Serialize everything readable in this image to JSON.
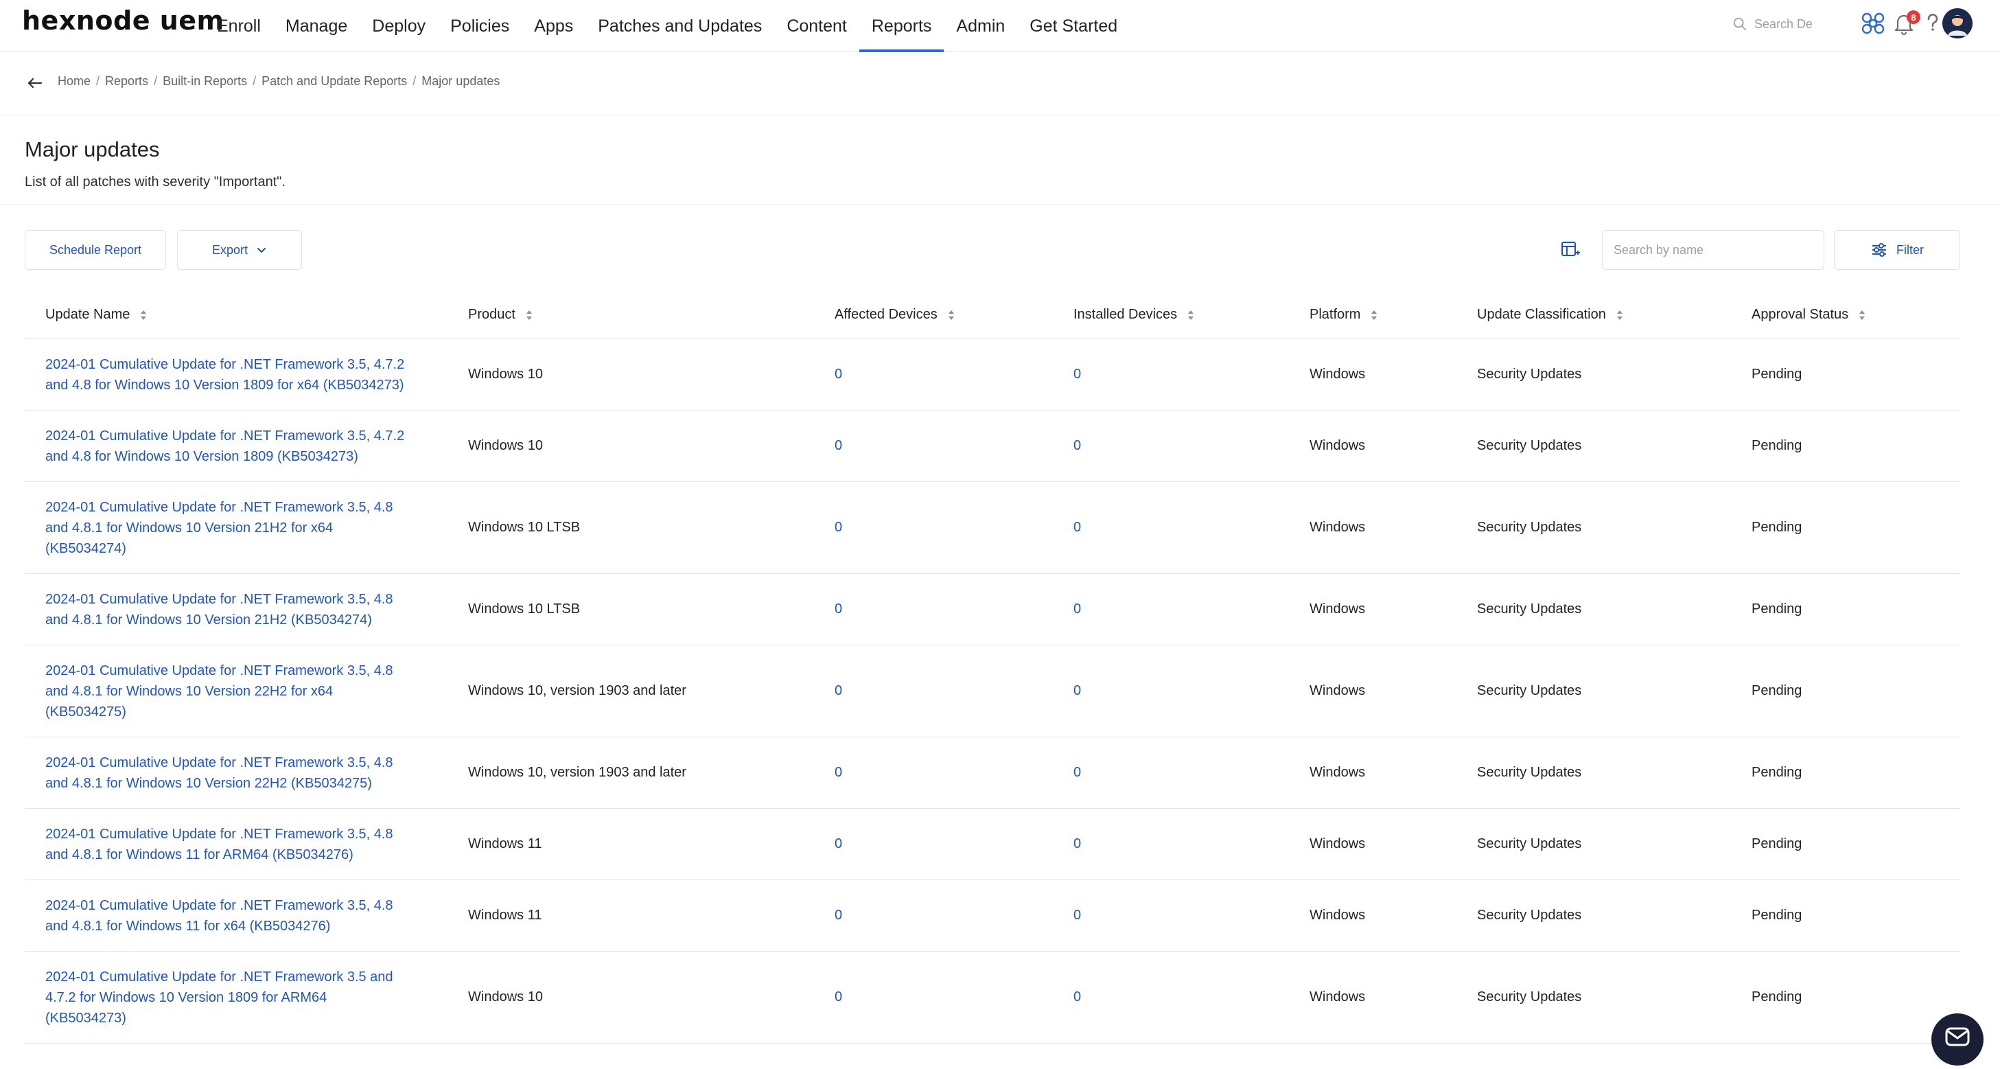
{
  "brand": {
    "logo_text": "hexnode uem"
  },
  "nav": {
    "items": [
      {
        "label": "Enroll"
      },
      {
        "label": "Manage"
      },
      {
        "label": "Deploy"
      },
      {
        "label": "Policies"
      },
      {
        "label": "Apps"
      },
      {
        "label": "Patches and Updates"
      },
      {
        "label": "Content"
      },
      {
        "label": "Reports"
      },
      {
        "label": "Admin"
      },
      {
        "label": "Get Started"
      }
    ],
    "active": "Reports",
    "search_placeholder": "Search De",
    "notification_count": "8"
  },
  "breadcrumb": [
    "Home",
    "Reports",
    "Built-in Reports",
    "Patch and Update Reports",
    "Major updates"
  ],
  "header": {
    "title": "Major updates",
    "description": "List of all patches with severity \"Important\"."
  },
  "toolbar": {
    "schedule_label": "Schedule Report",
    "export_label": "Export",
    "search_placeholder": "Search by name",
    "filter_label": "Filter"
  },
  "table": {
    "columns": [
      "Update Name",
      "Product",
      "Affected Devices",
      "Installed Devices",
      "Platform",
      "Update Classification",
      "Approval Status"
    ],
    "rows": [
      {
        "name_lines": [
          "2024-01 Cumulative Update for .NET Framework 3.5, 4.7.2",
          "and 4.8 for Windows 10 Version 1809 for x64 (KB5034273)"
        ],
        "product": "Windows 10",
        "affected": "0",
        "installed": "0",
        "platform": "Windows",
        "classification": "Security Updates",
        "status": "Pending"
      },
      {
        "name_lines": [
          "2024-01 Cumulative Update for .NET Framework 3.5, 4.7.2",
          "and 4.8 for Windows 10 Version 1809 (KB5034273)"
        ],
        "product": "Windows 10",
        "affected": "0",
        "installed": "0",
        "platform": "Windows",
        "classification": "Security Updates",
        "status": "Pending"
      },
      {
        "name_lines": [
          "2024-01 Cumulative Update for .NET Framework 3.5, 4.8",
          "and 4.8.1 for Windows 10 Version 21H2 for x64",
          "(KB5034274)"
        ],
        "product": "Windows 10 LTSB",
        "affected": "0",
        "installed": "0",
        "platform": "Windows",
        "classification": "Security Updates",
        "status": "Pending"
      },
      {
        "name_lines": [
          "2024-01 Cumulative Update for .NET Framework 3.5, 4.8",
          "and 4.8.1 for Windows 10 Version 21H2 (KB5034274)"
        ],
        "product": "Windows 10 LTSB",
        "affected": "0",
        "installed": "0",
        "platform": "Windows",
        "classification": "Security Updates",
        "status": "Pending"
      },
      {
        "name_lines": [
          "2024-01 Cumulative Update for .NET Framework 3.5, 4.8",
          "and 4.8.1 for Windows 10 Version 22H2 for x64",
          "(KB5034275)"
        ],
        "product": "Windows 10, version 1903 and later",
        "affected": "0",
        "installed": "0",
        "platform": "Windows",
        "classification": "Security Updates",
        "status": "Pending"
      },
      {
        "name_lines": [
          "2024-01 Cumulative Update for .NET Framework 3.5, 4.8",
          "and 4.8.1 for Windows 10 Version 22H2 (KB5034275)"
        ],
        "product": "Windows 10, version 1903 and later",
        "affected": "0",
        "installed": "0",
        "platform": "Windows",
        "classification": "Security Updates",
        "status": "Pending"
      },
      {
        "name_lines": [
          "2024-01 Cumulative Update for .NET Framework 3.5, 4.8",
          "and 4.8.1 for Windows 11 for ARM64 (KB5034276)"
        ],
        "product": "Windows 11",
        "affected": "0",
        "installed": "0",
        "platform": "Windows",
        "classification": "Security Updates",
        "status": "Pending"
      },
      {
        "name_lines": [
          "2024-01 Cumulative Update for .NET Framework 3.5, 4.8",
          "and 4.8.1 for Windows 11 for x64 (KB5034276)"
        ],
        "product": "Windows 11",
        "affected": "0",
        "installed": "0",
        "platform": "Windows",
        "classification": "Security Updates",
        "status": "Pending"
      },
      {
        "name_lines": [
          "2024-01 Cumulative Update for .NET Framework 3.5 and",
          "4.7.2 for Windows 10 Version 1809 for ARM64",
          "(KB5034273)"
        ],
        "product": "Windows 10",
        "affected": "0",
        "installed": "0",
        "platform": "Windows",
        "classification": "Security Updates",
        "status": "Pending"
      }
    ]
  },
  "colors": {
    "accent": "#2f6bd8",
    "link": "#1f55c8",
    "badge": "#e53935"
  }
}
